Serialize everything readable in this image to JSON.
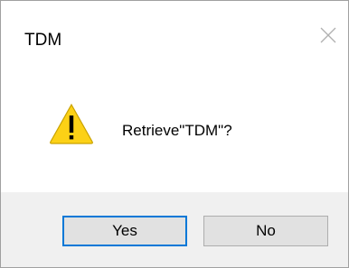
{
  "window": {
    "title": "TDM",
    "close_icon": "close-icon"
  },
  "message": {
    "icon": "warning-icon",
    "text": "Retrieve\"TDM\"?"
  },
  "buttons": {
    "yes_label": "Yes",
    "no_label": "No"
  },
  "colors": {
    "warning_fill": "#FCD116",
    "focus_border": "#0078D7",
    "footer_bg": "#F0F0F0"
  }
}
